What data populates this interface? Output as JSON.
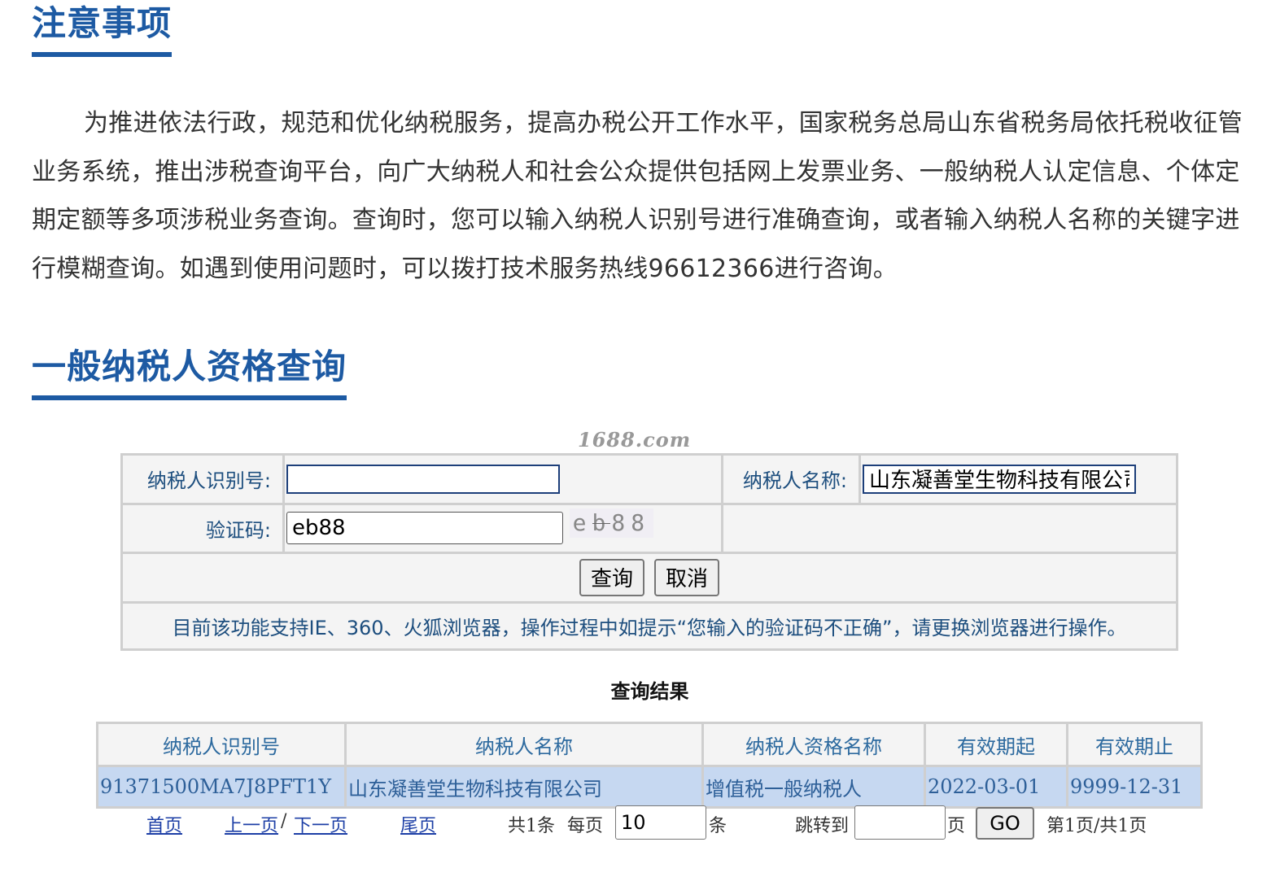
{
  "notice": {
    "title": "注意事项",
    "body": "为推进依法行政，规范和优化纳税服务，提高办税公开工作水平，国家税务总局山东省税务局依托税收征管业务系统，推出涉税查询平台，向广大纳税人和社会公众提供包括网上发票业务、一般纳税人认定信息、个体定期定额等多项涉税业务查询。查询时，您可以输入纳税人识别号进行准确查询，或者输入纳税人名称的关键字进行模糊查询。如遇到使用问题时，可以拨打技术服务热线96612366进行咨询。"
  },
  "query": {
    "title": "一般纳税人资格查询",
    "watermark": "1688.com",
    "taxpayer_id_label": "纳税人识别号:",
    "taxpayer_id_value": "",
    "taxpayer_name_label": "纳税人名称:",
    "taxpayer_name_value": "山东凝善堂生物科技有限公司",
    "captcha_label": "验证码:",
    "captcha_value": "eb88",
    "captcha_image_text": "eb88",
    "search_button": "查询",
    "cancel_button": "取消",
    "tip": "目前该功能支持IE、360、火狐浏览器，操作过程中如提示“您输入的验证码不正确”，请更换浏览器进行操作。"
  },
  "results": {
    "title": "查询结果",
    "columns": [
      "纳税人识别号",
      "纳税人名称",
      "纳税人资格名称",
      "有效期起",
      "有效期止"
    ],
    "rows": [
      [
        "91371500MA7J8PFT1Y",
        "山东凝善堂生物科技有限公司",
        "增值税一般纳税人",
        "2022-03-01",
        "9999-12-31"
      ]
    ]
  },
  "pager": {
    "first": "首页",
    "prev": "上一页",
    "sep": "/",
    "next": "下一页",
    "last": "尾页",
    "total": "共1条",
    "per_page_label": "每页",
    "per_page_value": "10",
    "per_page_unit": "条",
    "jump_label": "跳转到",
    "jump_value": "",
    "page_unit": "页",
    "go_button": "GO",
    "page_info": "第1页/共1页"
  }
}
